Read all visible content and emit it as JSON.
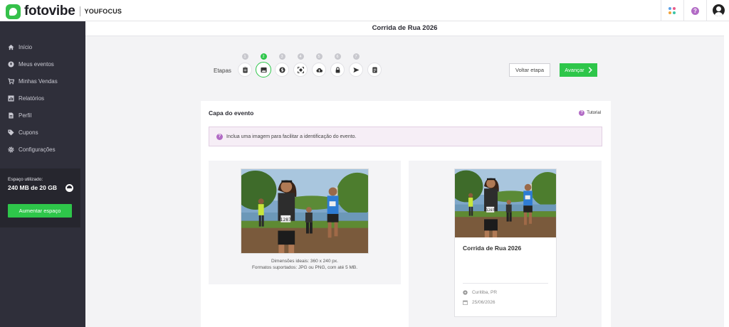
{
  "brand": {
    "name": "fotovibe",
    "sub": "YOUFOCUS"
  },
  "colors": {
    "accent": "#2ec64a",
    "sidebar": "#2f2f3a",
    "help": "#b26bc5"
  },
  "topbar": {
    "apps_icon": "apps-grid-icon",
    "help_icon": "help-icon",
    "user_icon": "user-avatar-icon"
  },
  "sidebar": {
    "items": [
      {
        "label": "Início",
        "icon": "home-icon"
      },
      {
        "label": "Meus eventos",
        "icon": "events-icon"
      },
      {
        "label": "Minhas Vendas",
        "icon": "cart-icon"
      },
      {
        "label": "Relatórios",
        "icon": "reports-icon"
      },
      {
        "label": "Perfil",
        "icon": "profile-icon"
      },
      {
        "label": "Cupons",
        "icon": "tag-icon"
      },
      {
        "label": "Configurações",
        "icon": "gear-icon"
      }
    ],
    "storage": {
      "label": "Espaço utilizado:",
      "value": "240 MB de 20 GB",
      "button": "Aumentar espaço"
    }
  },
  "page": {
    "title": "Corrida de Rua 2026"
  },
  "steps": {
    "label": "Etapas",
    "items": [
      {
        "num": "1",
        "icon": "clipboard-icon"
      },
      {
        "num": "2",
        "icon": "image-icon",
        "active": true
      },
      {
        "num": "3",
        "icon": "dollar-icon"
      },
      {
        "num": "4",
        "icon": "face-scan-icon"
      },
      {
        "num": "5",
        "icon": "upload-cloud-icon"
      },
      {
        "num": "6",
        "icon": "lock-icon"
      },
      {
        "num": "7",
        "icon": "send-icon"
      },
      {
        "num": "",
        "icon": "summary-icon"
      }
    ]
  },
  "actions": {
    "back": "Voltar etapa",
    "next": "Avançar"
  },
  "cover": {
    "title": "Capa do evento",
    "tutorial": "Tutorial",
    "info": "Inclua uma imagem para facilitar a identificação do evento.",
    "dims_line1": "Dimensões ideais: 360 x 240 px.",
    "dims_line2": "Formatos suportados: JPG ou PNG, com até 5 MB."
  },
  "preview": {
    "title": "Corrida de Rua 2026",
    "location": "Curitiba, PR",
    "date": "25/06/2026"
  }
}
